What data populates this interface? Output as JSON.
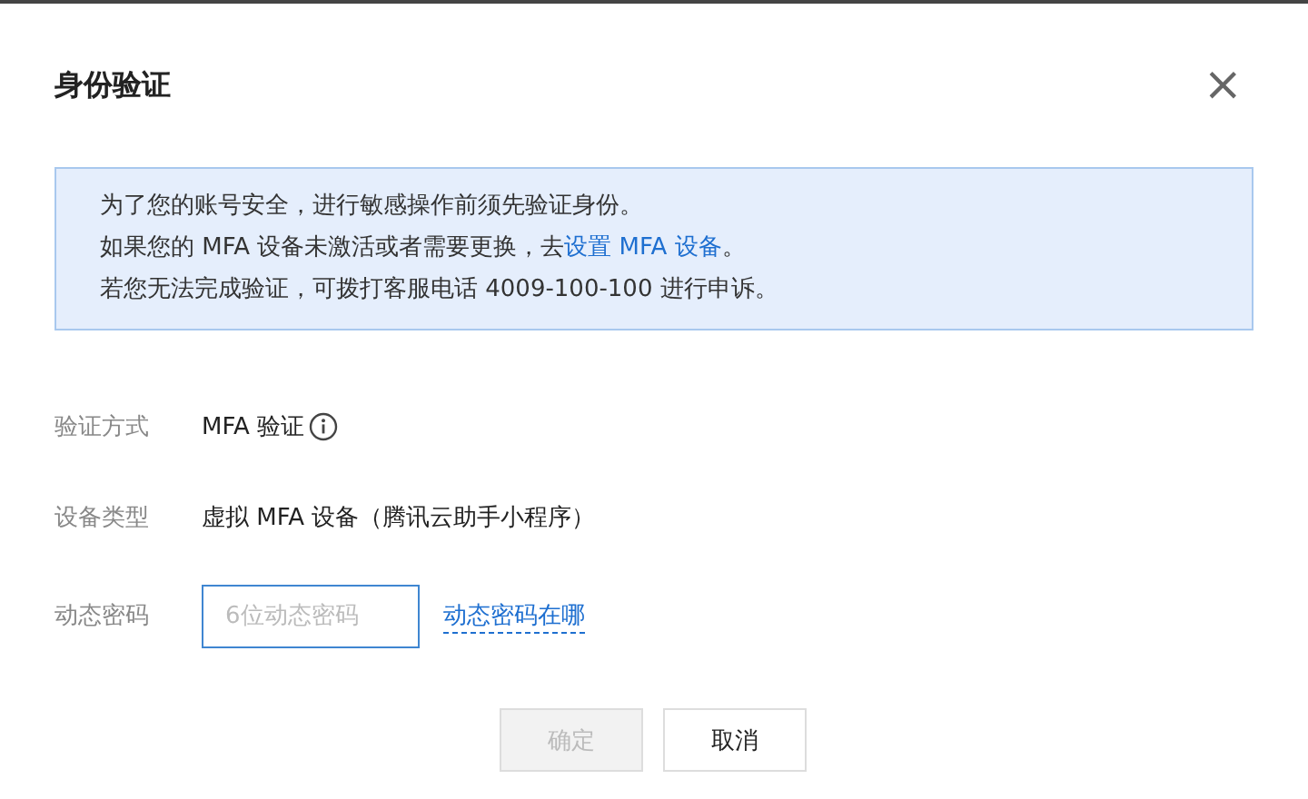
{
  "dialog": {
    "title": "身份验证",
    "close": "×"
  },
  "notice": {
    "lines": [
      {
        "parts": [
          {
            "kind": "text",
            "text": "为了您的账号安全，进行敏感操作前须先验证身份。"
          }
        ]
      },
      {
        "parts": [
          {
            "kind": "text",
            "text": "如果您的 MFA 设备未激活或者需要更换，去"
          },
          {
            "kind": "link",
            "text": "设置 MFA 设备"
          },
          {
            "kind": "text",
            "text": "。"
          }
        ]
      },
      {
        "parts": [
          {
            "kind": "text",
            "text": "若您无法完成验证，可拨打客服电话 4009-100-100 进行申诉。"
          }
        ]
      }
    ]
  },
  "form": [
    {
      "kind": "info",
      "label": "验证方式",
      "value": "MFA 验证"
    },
    {
      "kind": "text",
      "label": "设备类型",
      "value": "虚拟 MFA 设备（腾讯云助手小程序）"
    },
    {
      "kind": "input",
      "label": "动态密码",
      "placeholder": "6位动态密码",
      "link": "动态密码在哪"
    }
  ],
  "buttons": [
    {
      "label": "确定",
      "disabled": true
    },
    {
      "label": "取消",
      "disabled": false
    }
  ]
}
